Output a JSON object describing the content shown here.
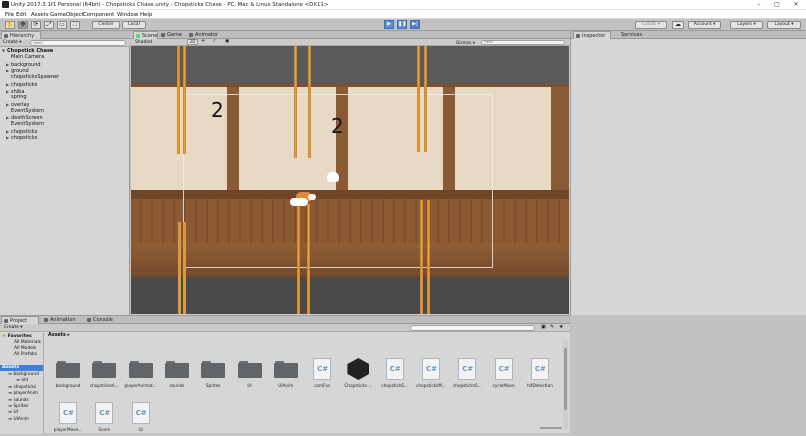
{
  "window": {
    "title": "Unity 2017.3.1f1 Personal (64bit) - Chopsticks Chase.unity - Chopsticks Chase - PC, Mac & Linux Standalone <DX11>",
    "minimize": "–",
    "maximize": "□",
    "close": "✕"
  },
  "menu": [
    "File",
    "Edit",
    "Assets",
    "GameObject",
    "Component",
    "Window",
    "Help"
  ],
  "toolbar": {
    "tools": [
      "✋",
      "✥",
      "⟳",
      "⤢",
      "▭",
      "⛶"
    ],
    "pivot": "Center",
    "space": "Local",
    "play": "▶",
    "pause": "❚❚",
    "step": "▶|",
    "collab": "Collab ▾",
    "account": "Account ▾",
    "layers": "Layers ▾",
    "layout": "Layout ▾"
  },
  "hierarchy": {
    "tab": "Hierarchy",
    "create": "Create ▾",
    "search_placeholder": "Q▾All",
    "scene": "Chopstick Chase",
    "items": [
      {
        "label": "Main Camera",
        "arrow": ""
      },
      {
        "label": "background",
        "arrow": "▶"
      },
      {
        "label": "ground",
        "arrow": "▶"
      },
      {
        "label": "chopsticksSpawner",
        "arrow": ""
      },
      {
        "label": "chopsticks",
        "arrow": "▶"
      },
      {
        "label": "shiba",
        "arrow": "▶"
      },
      {
        "label": "spring",
        "arrow": ""
      },
      {
        "label": "overlay",
        "arrow": "▶"
      },
      {
        "label": "EventSystem",
        "arrow": ""
      },
      {
        "label": "deathScreen",
        "arrow": "▶"
      },
      {
        "label": "EventSystem",
        "arrow": ""
      },
      {
        "label": "chopsticks",
        "arrow": "▶"
      },
      {
        "label": "chopsticks",
        "arrow": "▶"
      }
    ]
  },
  "scene_view": {
    "tabs": [
      "Scene",
      "Game",
      "Animator"
    ],
    "shading": "Shaded",
    "mode_2d": "2D",
    "gizmos": "Gizmos ▾",
    "search_placeholder": "Q▾All",
    "score_left": "2",
    "score_right": "2"
  },
  "inspector": {
    "tabs": [
      "Inspector",
      "Services"
    ]
  },
  "project": {
    "tabs": [
      "Project",
      "Animation",
      "Console"
    ],
    "create": "Create ▾",
    "favorites_label": "Favorites",
    "favorites": [
      "All Materials",
      "All Models",
      "All Prefabs"
    ],
    "assets_label": "Assets",
    "asset_tree": [
      "background",
      "old",
      "chopsticks",
      "playerAnim",
      "sounds",
      "Sprites",
      "UI",
      "UIAnim"
    ],
    "breadcrumb": "Assets ▸",
    "items": [
      {
        "label": "background",
        "kind": "folder"
      },
      {
        "label": "chopsticksA...",
        "kind": "folder"
      },
      {
        "label": "playerAnimat...",
        "kind": "folder"
      },
      {
        "label": "sounds",
        "kind": "folder"
      },
      {
        "label": "Sprites",
        "kind": "folder"
      },
      {
        "label": "UI",
        "kind": "folder"
      },
      {
        "label": "UIAnim",
        "kind": "folder"
      },
      {
        "label": "camFos",
        "kind": "cs"
      },
      {
        "label": "Chopsticks ...",
        "kind": "unity"
      },
      {
        "label": "chopstickS...",
        "kind": "cs"
      },
      {
        "label": "chopsticksM...",
        "kind": "cs"
      },
      {
        "label": "chopsticksS...",
        "kind": "cs"
      },
      {
        "label": "cycleMove",
        "kind": "cs"
      },
      {
        "label": "hitDetection",
        "kind": "cs"
      },
      {
        "label": "playerMove...",
        "kind": "cs"
      },
      {
        "label": "Score",
        "kind": "cs"
      },
      {
        "label": "UI",
        "kind": "cs"
      }
    ],
    "cs_glyph": "C#"
  }
}
